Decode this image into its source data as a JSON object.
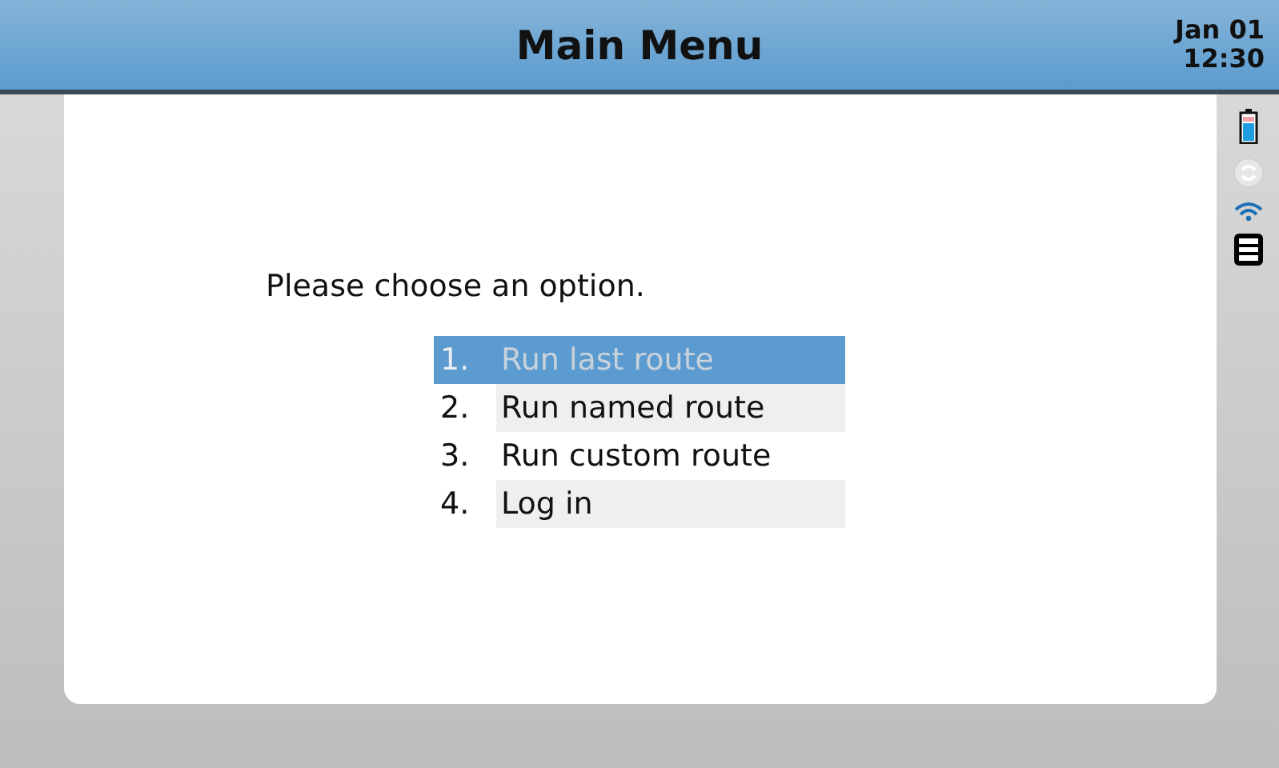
{
  "header": {
    "title": "Main Menu",
    "date": "Jan 01",
    "time": "12:30"
  },
  "prompt": "Please choose an option.",
  "options": [
    {
      "number": "1.",
      "label": "Run last route",
      "selected": true
    },
    {
      "number": "2.",
      "label": "Run named route",
      "selected": false
    },
    {
      "number": "3.",
      "label": "Run custom route",
      "selected": false
    },
    {
      "number": "4.",
      "label": "Log in",
      "selected": false
    }
  ]
}
